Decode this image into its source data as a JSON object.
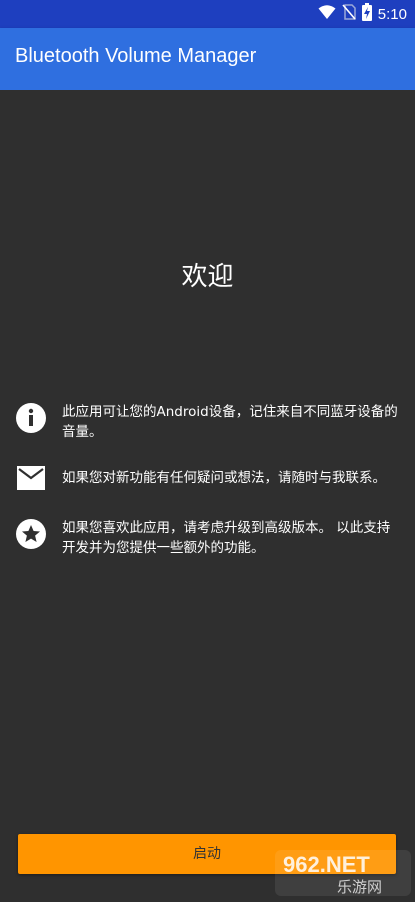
{
  "status_bar": {
    "time": "5:10",
    "icons": [
      "wifi-icon",
      "no-sim-icon",
      "battery-charging-icon"
    ]
  },
  "app_bar": {
    "title": "Bluetooth Volume Manager"
  },
  "main": {
    "welcome": "欢迎",
    "rows": [
      {
        "icon": "info-icon",
        "text": "此应用可让您的Android设备，记住来自不同蓝牙设备的音量。"
      },
      {
        "icon": "mail-icon",
        "text": "如果您对新功能有任何疑问或想法，请随时与我联系。"
      },
      {
        "icon": "star-icon",
        "text": "如果您喜欢此应用，请考虑升级到高级版本。 以此支持开发并为您提供一些额外的功能。"
      }
    ]
  },
  "start_button": {
    "label": "启动"
  },
  "watermark": {
    "line1": "962.NET",
    "line2": "乐游网"
  },
  "colors": {
    "status_bar": "#1e3fbf",
    "app_bar": "#2f6fe0",
    "background": "#2f2f2f",
    "button": "#ff9500"
  }
}
